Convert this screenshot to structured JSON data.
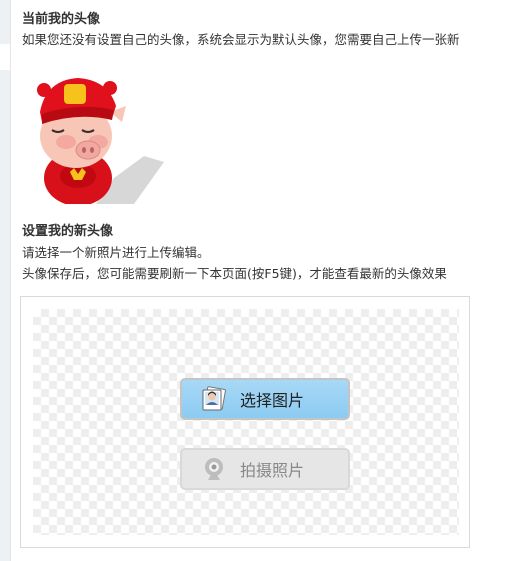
{
  "current_avatar": {
    "title": "当前我的头像",
    "description": "如果您还没有设置自己的头像，系统会显示为默认头像，您需要自己上传一张新"
  },
  "new_avatar": {
    "title": "设置我的新头像",
    "instruction": "请选择一个新照片进行上传编辑。",
    "note": "头像保存后，您可能需要刷新一下本页面(按F5键)，才能查看最新的头像效果"
  },
  "upload": {
    "select_label": "选择图片",
    "capture_label": "拍摄照片",
    "select_icon": "photo-icon",
    "capture_icon": "webcam-icon"
  },
  "colors": {
    "select_button": "#8ccbf2",
    "capture_button_disabled": "#e6e6e6"
  }
}
